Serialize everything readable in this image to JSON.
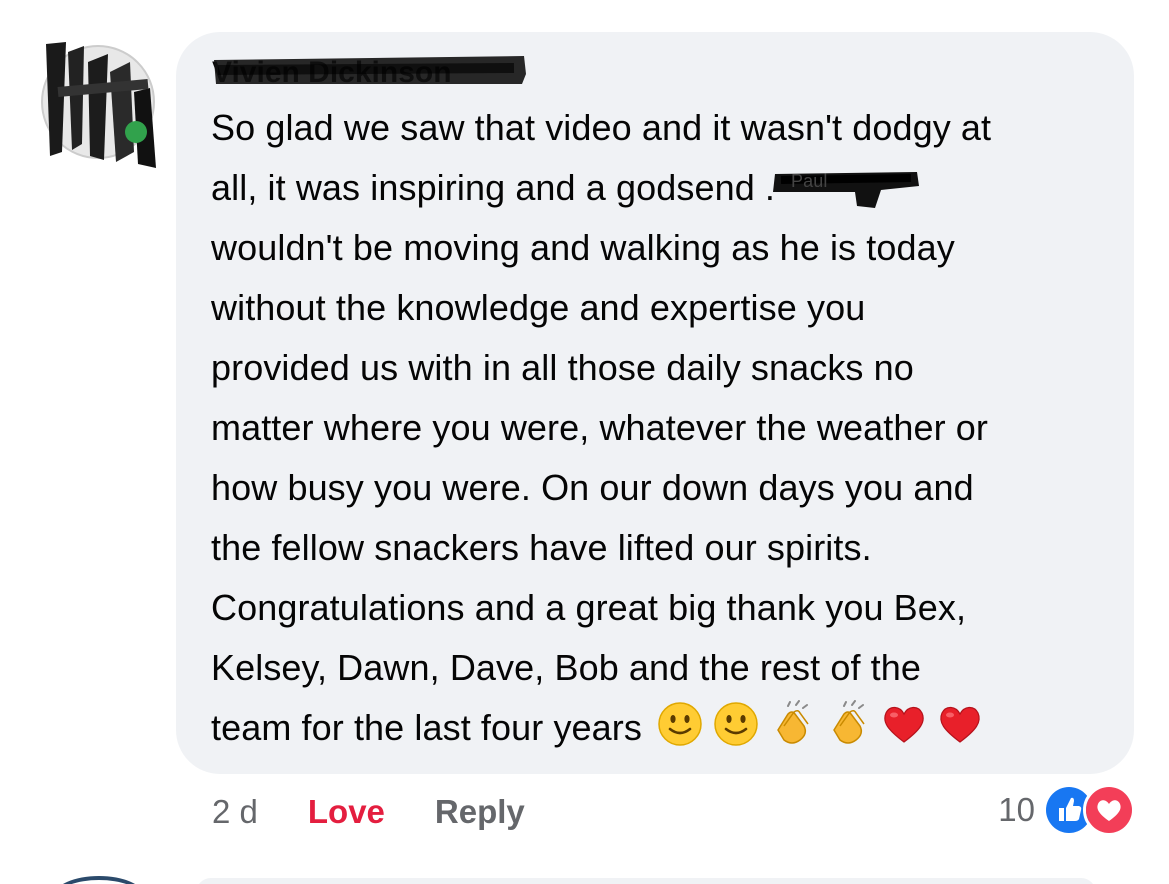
{
  "comment": {
    "author": "Vivien Dickinson",
    "redacted_name": "Paul",
    "lines": [
      "So glad we saw that video and it wasn't dodgy at",
      "all, it was inspiring and a godsend .",
      "wouldn't be moving and walking as he is today",
      "without the knowledge and expertise you",
      "provided us with in all those  daily snacks no",
      "matter where you were, whatever the weather or",
      "how busy you were. On our down days you and",
      "the fellow snackers have lifted our spirits.",
      "Congratulations  and a great big thank you Bex,",
      "Kelsey, Dawn, Dave, Bob and the rest of the",
      "team for the last four years"
    ],
    "emojis": [
      "slightly-smiling-face-icon",
      "slightly-smiling-face-icon",
      "clapping-hands-icon",
      "clapping-hands-icon",
      "red-heart-icon",
      "red-heart-icon"
    ]
  },
  "actions": {
    "timestamp": "2 d",
    "love_label": "Love",
    "reply_label": "Reply"
  },
  "reactions": {
    "count": "10",
    "icons": [
      "like-icon",
      "love-icon"
    ],
    "colors": {
      "like": "#1877f2",
      "love": "#f33e58"
    }
  },
  "colors": {
    "bubble": "#f0f2f5",
    "text": "#050505",
    "muted": "#65676b",
    "love_action": "#e41e3f"
  }
}
